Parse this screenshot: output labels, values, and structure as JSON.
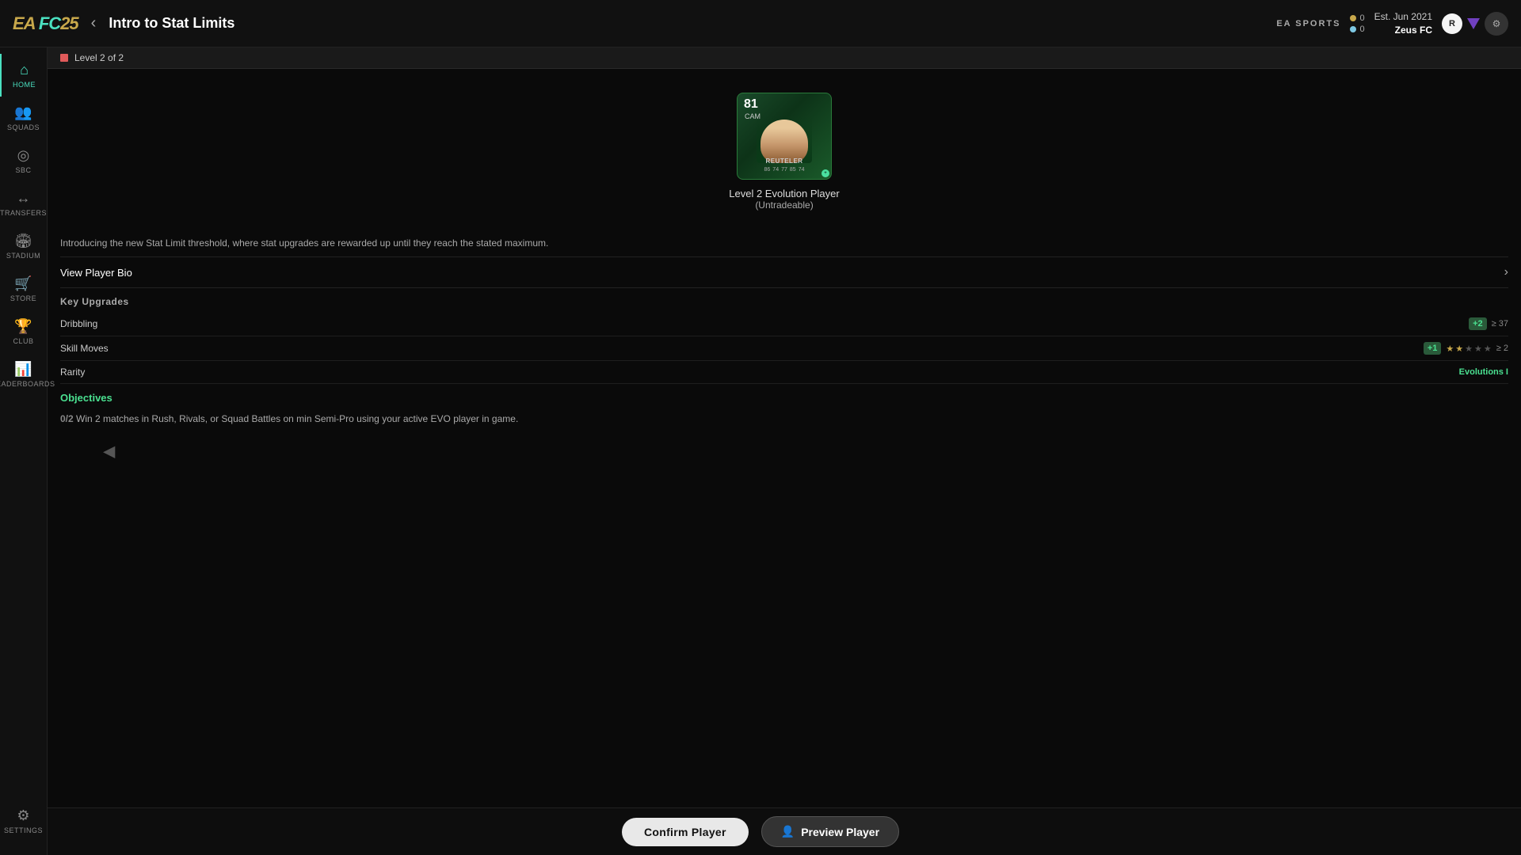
{
  "app": {
    "logo": "EA FC 25",
    "logo_ea": "EA SPORTS"
  },
  "topbar": {
    "back_label": "‹",
    "title": "Intro to Stat Limits",
    "coins": "0",
    "points": "0",
    "est_label": "Est. Jun 2021",
    "club_name": "Zeus FC"
  },
  "sidebar": {
    "items": [
      {
        "id": "home",
        "icon": "⌂",
        "label": "Home",
        "active": true
      },
      {
        "id": "squads",
        "icon": "👥",
        "label": "Squads",
        "active": false
      },
      {
        "id": "sbc",
        "icon": "◎",
        "label": "SBC",
        "active": false
      },
      {
        "id": "transfers",
        "icon": "↔",
        "label": "Transfers",
        "active": false
      },
      {
        "id": "stadium",
        "icon": "🏟",
        "label": "Stadium",
        "active": false
      },
      {
        "id": "store",
        "icon": "🛒",
        "label": "Store",
        "active": false
      },
      {
        "id": "club",
        "icon": "🏆",
        "label": "Club",
        "active": false
      },
      {
        "id": "leaderboards",
        "icon": "📊",
        "label": "Leaderboards",
        "active": false
      }
    ],
    "settings": {
      "icon": "⚙",
      "label": "Settings"
    }
  },
  "level_bar": {
    "text": "Level 2 of 2"
  },
  "player_card": {
    "rating": "81",
    "position": "CAM",
    "name": "Reuteler",
    "label": "Level 2 Evolution Player",
    "sublabel": "(Untradeable)"
  },
  "description": "Introducing the new Stat Limit threshold, where stat upgrades are rewarded up until they reach the stated maximum.",
  "view_bio": {
    "label": "View Player Bio"
  },
  "key_upgrades": {
    "section_label": "Key Upgrades",
    "items": [
      {
        "label": "Dribbling",
        "plus": "+2",
        "value": "37"
      },
      {
        "label": "Skill Moves",
        "plus": "+1",
        "stars": 2,
        "max_stars": 5,
        "value": "2"
      },
      {
        "label": "Rarity",
        "rarity_label": "Evolutions I"
      }
    ]
  },
  "objectives": {
    "section_label": "Objectives",
    "items": [
      {
        "progress": "0/2",
        "text": "Win 2 matches in Rush, Rivals, or Squad Battles on min Semi-Pro using your active EVO player in game."
      }
    ]
  },
  "bottom_bar": {
    "confirm_label": "Confirm Player",
    "preview_label": "Preview Player"
  }
}
